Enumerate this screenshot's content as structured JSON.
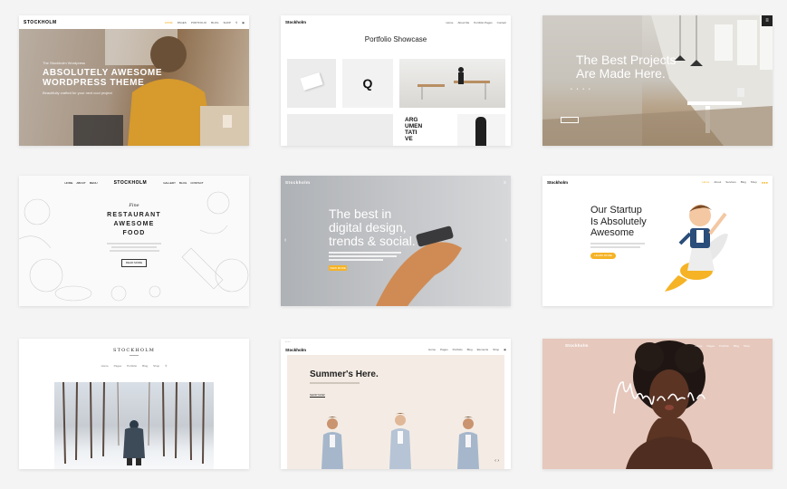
{
  "cards": {
    "c1": {
      "logo": "STOCKHOLM",
      "nav": [
        "HOME",
        "PAGES",
        "PORTFOLIO",
        "BLOG",
        "SHOP"
      ],
      "pre": "The Stockholm Wordpress",
      "title1": "ABSOLUTELY AWESOME",
      "title2": "WORDPRESS THEME",
      "sub": "Beautifully crafted for your next cool project"
    },
    "c2": {
      "logo": "Stockholm",
      "nav": [
        "Home",
        "About Me",
        "Portfolio Pages",
        "Contact"
      ],
      "title": "Portfolio Showcase",
      "q": "Q",
      "word": [
        "ARG",
        "UMEN",
        "TATI",
        "VE"
      ]
    },
    "c3": {
      "logo": "Stockholm",
      "title1": "The Best Projects",
      "title2": "Are Made Here."
    },
    "c4": {
      "logo": "STOCKHOLM",
      "nav_left": [
        "HOME",
        "ABOUT",
        "MENU"
      ],
      "nav_right": [
        "GALLERY",
        "BLOG",
        "CONTACT"
      ],
      "script": "Fine",
      "title1": "RESTAURANT",
      "title2": "AWESOME",
      "title3": "FOOD",
      "btn": "READ MORE"
    },
    "c5": {
      "logo": "Stockholm",
      "title1": "The best in",
      "title2": "digital design,",
      "title3": "trends & social.",
      "btn": "VIEW MORE"
    },
    "c6": {
      "logo": "Stockholm",
      "nav": [
        "Home",
        "About",
        "Services",
        "Blog",
        "Shop"
      ],
      "title1": "Our Startup",
      "title2": "Is Absolutely",
      "title3": "Awesome",
      "btn": "LEARN MORE"
    },
    "c7": {
      "logo": "STOCKHOLM",
      "nav": [
        "Home",
        "Pages",
        "Portfolio",
        "Blog",
        "Shop"
      ]
    },
    "c8": {
      "logo": "Stockholm",
      "nav": [
        "Home",
        "Pages",
        "Portfolio",
        "Blog",
        "Elements",
        "Shop"
      ],
      "title": "Summer's Here.",
      "btn": "SHOP NOW"
    },
    "c9": {
      "logo": "Stockholm",
      "nav": [
        "Home",
        "Pages",
        "Portfolio",
        "Blog",
        "Shop"
      ],
      "signature": "Mayra Silva"
    }
  },
  "colors": {
    "accent": "#f5b325",
    "dark": "#222222",
    "white": "#ffffff"
  }
}
